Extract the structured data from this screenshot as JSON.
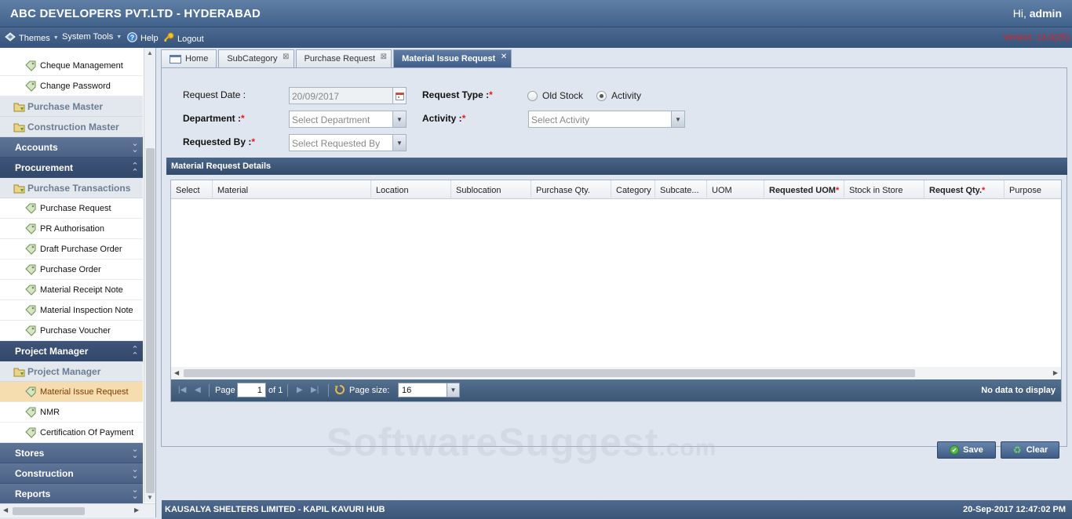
{
  "header": {
    "title": "ABC DEVELOPERS PVT.LTD - HYDERABAD",
    "greeting": "Hi,",
    "user": "admin"
  },
  "menu": {
    "themes": "Themes",
    "system_tools": "System Tools",
    "help": "Help",
    "logout": "Logout",
    "version": "Version: 13.0(25)"
  },
  "sidebar": {
    "items": [
      {
        "label": "Cheque Management"
      },
      {
        "label": "Change Password"
      },
      {
        "label": "Purchase Master"
      },
      {
        "label": "Construction Master"
      },
      {
        "label": "Accounts"
      },
      {
        "label": "Procurement"
      },
      {
        "label": "Purchase Transactions"
      },
      {
        "label": "Purchase Request"
      },
      {
        "label": "PR Authorisation"
      },
      {
        "label": "Draft Purchase Order"
      },
      {
        "label": "Purchase Order"
      },
      {
        "label": "Material Receipt Note"
      },
      {
        "label": "Material Inspection Note"
      },
      {
        "label": "Purchase Voucher"
      },
      {
        "label": "Project Manager"
      },
      {
        "label": "Project Manager"
      },
      {
        "label": "Material Issue Request"
      },
      {
        "label": "NMR"
      },
      {
        "label": "Certification Of Payment"
      },
      {
        "label": "Stores"
      },
      {
        "label": "Construction"
      },
      {
        "label": "Reports"
      }
    ]
  },
  "tabs": [
    {
      "label": "Home"
    },
    {
      "label": "SubCategory"
    },
    {
      "label": "Purchase Request"
    },
    {
      "label": "Material Issue Request"
    }
  ],
  "form": {
    "request_date_label": "Request Date :",
    "request_date_value": "20/09/2017",
    "department_label": "Department :",
    "department_placeholder": "Select Department",
    "requested_by_label": "Requested By :",
    "requested_by_placeholder": "Select Requested By",
    "request_type_label": "Request Type :",
    "option_old_stock": "Old Stock",
    "option_activity": "Activity",
    "selected_request_type": "Activity",
    "activity_label": "Activity :",
    "activity_placeholder": "Select Activity",
    "required_mark": "*"
  },
  "grid": {
    "title": "Material Request Details",
    "columns": [
      {
        "label": "Select"
      },
      {
        "label": "Material"
      },
      {
        "label": "Location"
      },
      {
        "label": "Sublocation"
      },
      {
        "label": "Purchase Qty."
      },
      {
        "label": "Category"
      },
      {
        "label": "Subcate..."
      },
      {
        "label": "UOM"
      },
      {
        "label": "Requested UOM"
      },
      {
        "label": "Stock in Store"
      },
      {
        "label": "Request Qty."
      },
      {
        "label": "Purpose"
      }
    ],
    "pager": {
      "page_label": "Page",
      "page_value": "1",
      "of_label": "of 1",
      "page_size_label": "Page size:",
      "page_size_value": "16",
      "status": "No data to display"
    }
  },
  "actions": {
    "save": "Save",
    "clear": "Clear"
  },
  "watermark": {
    "text": "SoftwareSuggest",
    "suffix": ".com"
  },
  "footer": {
    "company": "KAUSALYA SHELTERS LIMITED - KAPIL KAVURI HUB",
    "datetime": "20-Sep-2017 12:47:02 PM"
  }
}
